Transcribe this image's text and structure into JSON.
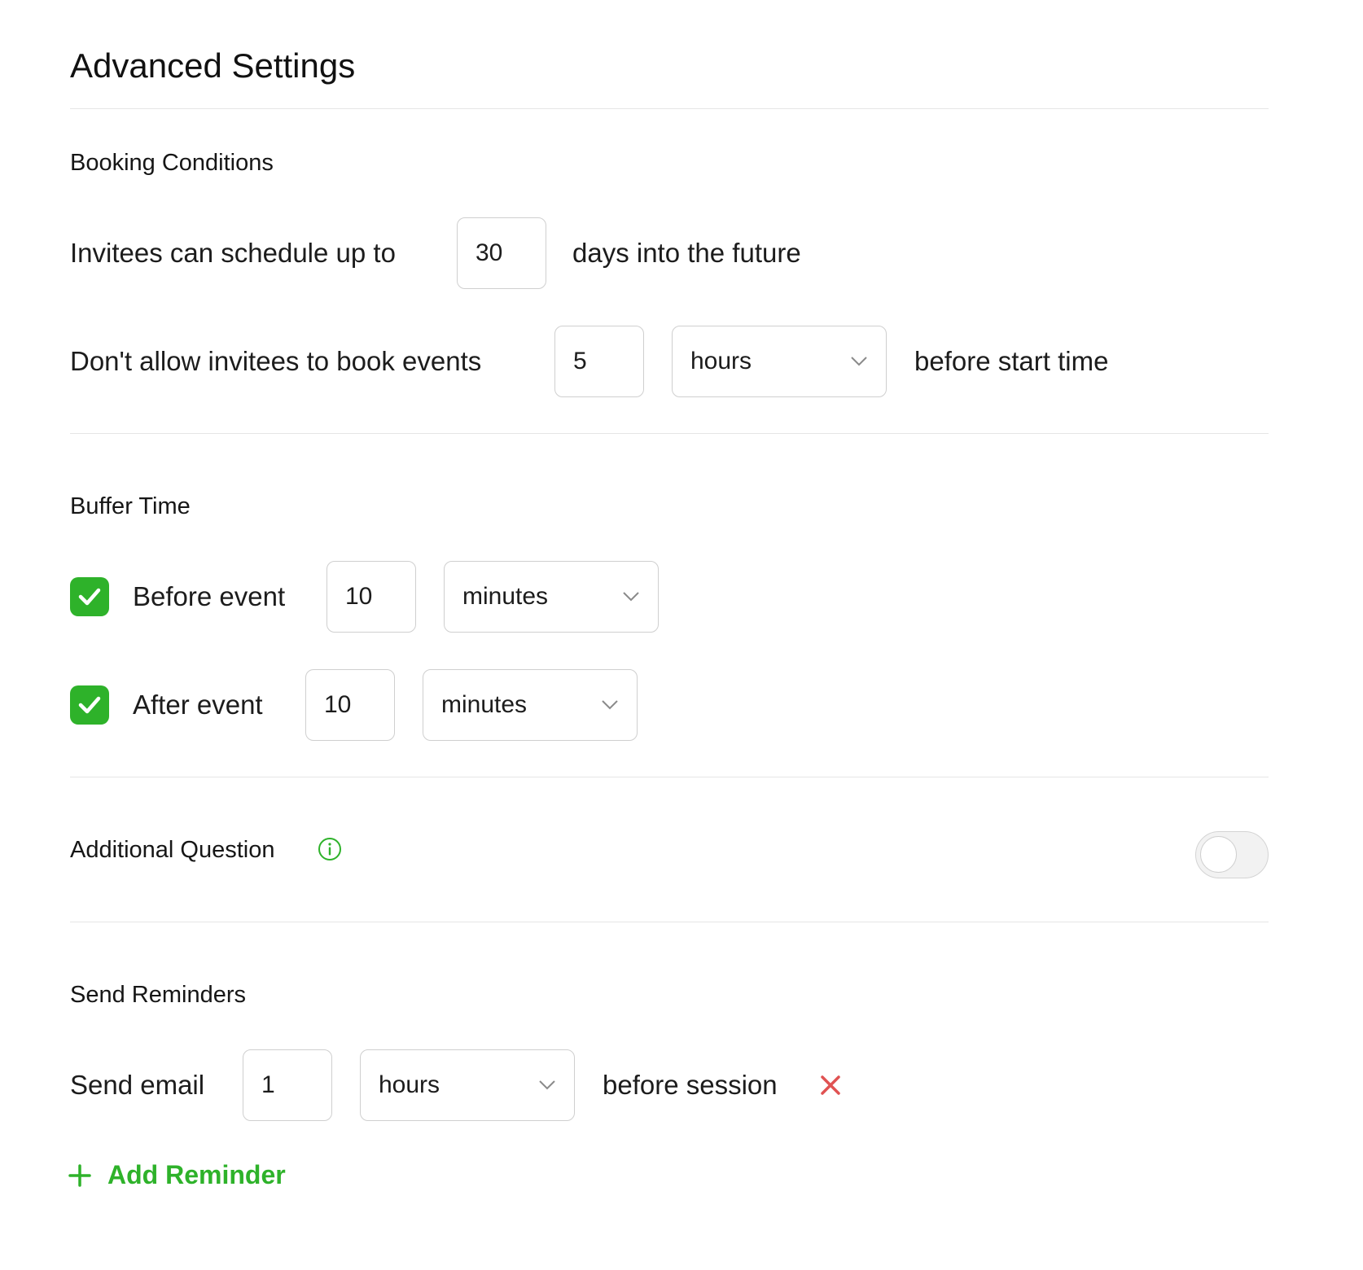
{
  "page": {
    "title": "Advanced Settings"
  },
  "booking_conditions": {
    "heading": "Booking Conditions",
    "schedule_prefix": "Invitees can schedule up to",
    "schedule_days": "30",
    "schedule_suffix": "days into the future",
    "notice_prefix": "Don't allow invitees to book events",
    "notice_value": "5",
    "notice_unit": "hours",
    "notice_suffix": "before start time"
  },
  "buffer_time": {
    "heading": "Buffer Time",
    "before": {
      "checked": true,
      "label": "Before event",
      "value": "10",
      "unit": "minutes"
    },
    "after": {
      "checked": true,
      "label": "After event",
      "value": "10",
      "unit": "minutes"
    }
  },
  "additional_question": {
    "heading": "Additional Question",
    "info_icon": "info-icon",
    "toggle_on": false
  },
  "send_reminders": {
    "heading": "Send Reminders",
    "reminders": [
      {
        "prefix": "Send email",
        "value": "1",
        "unit": "hours",
        "suffix": "before session"
      }
    ],
    "add_label": "Add Reminder"
  },
  "colors": {
    "accent": "#2eb22a",
    "remove": "#e05252",
    "border": "#cfcfcf",
    "divider": "#e6e6e6"
  }
}
